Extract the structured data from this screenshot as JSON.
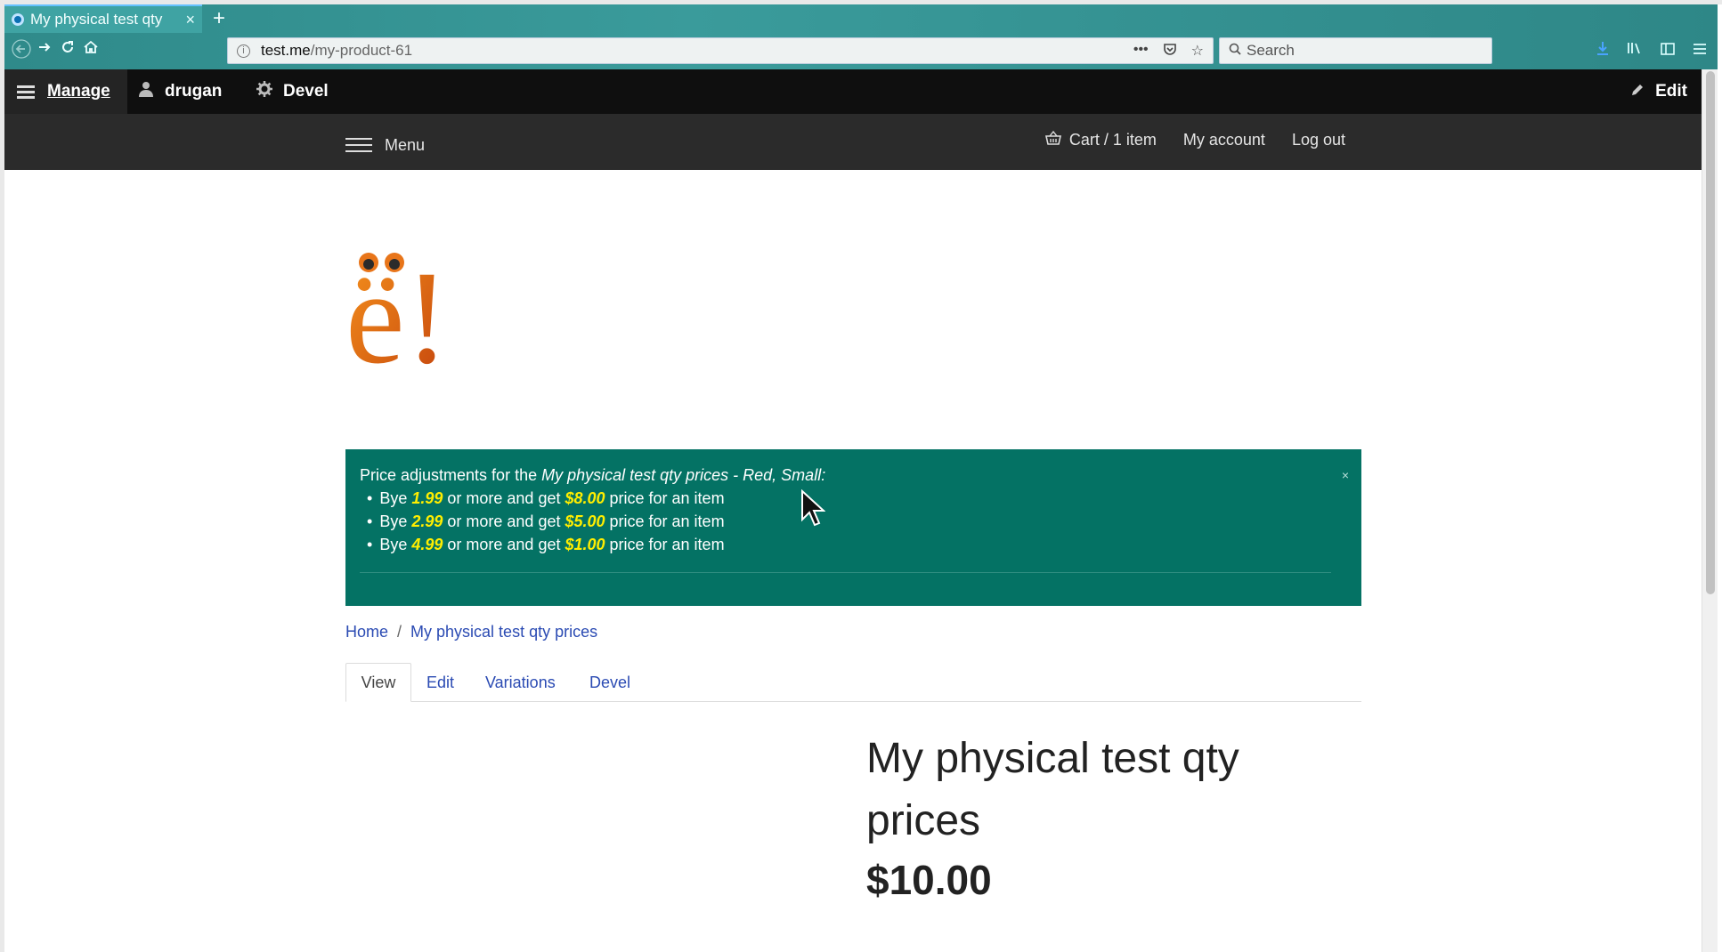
{
  "browser": {
    "tab_title": "My physical test qty",
    "tab_close": "×",
    "new_tab": "+",
    "url_host": "test.me",
    "url_path": "/my-product-61",
    "url_menu": "•••",
    "search_placeholder": "Search"
  },
  "admin_toolbar": {
    "manage": "Manage",
    "user": "drugan",
    "devel": "Devel",
    "edit": "Edit"
  },
  "site_header": {
    "menu": "Menu",
    "cart": "Cart / 1 item",
    "my_account": "My account",
    "log_out": "Log out"
  },
  "logo": {
    "text": "ë!"
  },
  "status_message": {
    "close": "×",
    "intro": "Price adjustments for the ",
    "product": "My physical test qty prices - Red, Small",
    "intro_end": ":",
    "items": [
      {
        "pre": "Bye ",
        "qty": "1.99",
        "mid": " or more and get ",
        "price": "$8.00",
        "post": " price for an item"
      },
      {
        "pre": "Bye ",
        "qty": "2.99",
        "mid": " or more and get ",
        "price": "$5.00",
        "post": " price for an item"
      },
      {
        "pre": "Bye ",
        "qty": "4.99",
        "mid": " or more and get ",
        "price": "$1.00",
        "post": " price for an item"
      }
    ]
  },
  "breadcrumb": {
    "home": "Home",
    "separator": "/",
    "current": "My physical test qty prices"
  },
  "tabs": [
    "View",
    "Edit",
    "Variations",
    "Devel"
  ],
  "product": {
    "title": "My physical test qty prices",
    "price": "$10.00"
  },
  "colors": {
    "status_bg": "#047264",
    "highlight": "#ffee00",
    "link": "#2b4bb3",
    "toolbar_bg": "#0f0f0f",
    "header_bg": "#2b2b2b"
  }
}
